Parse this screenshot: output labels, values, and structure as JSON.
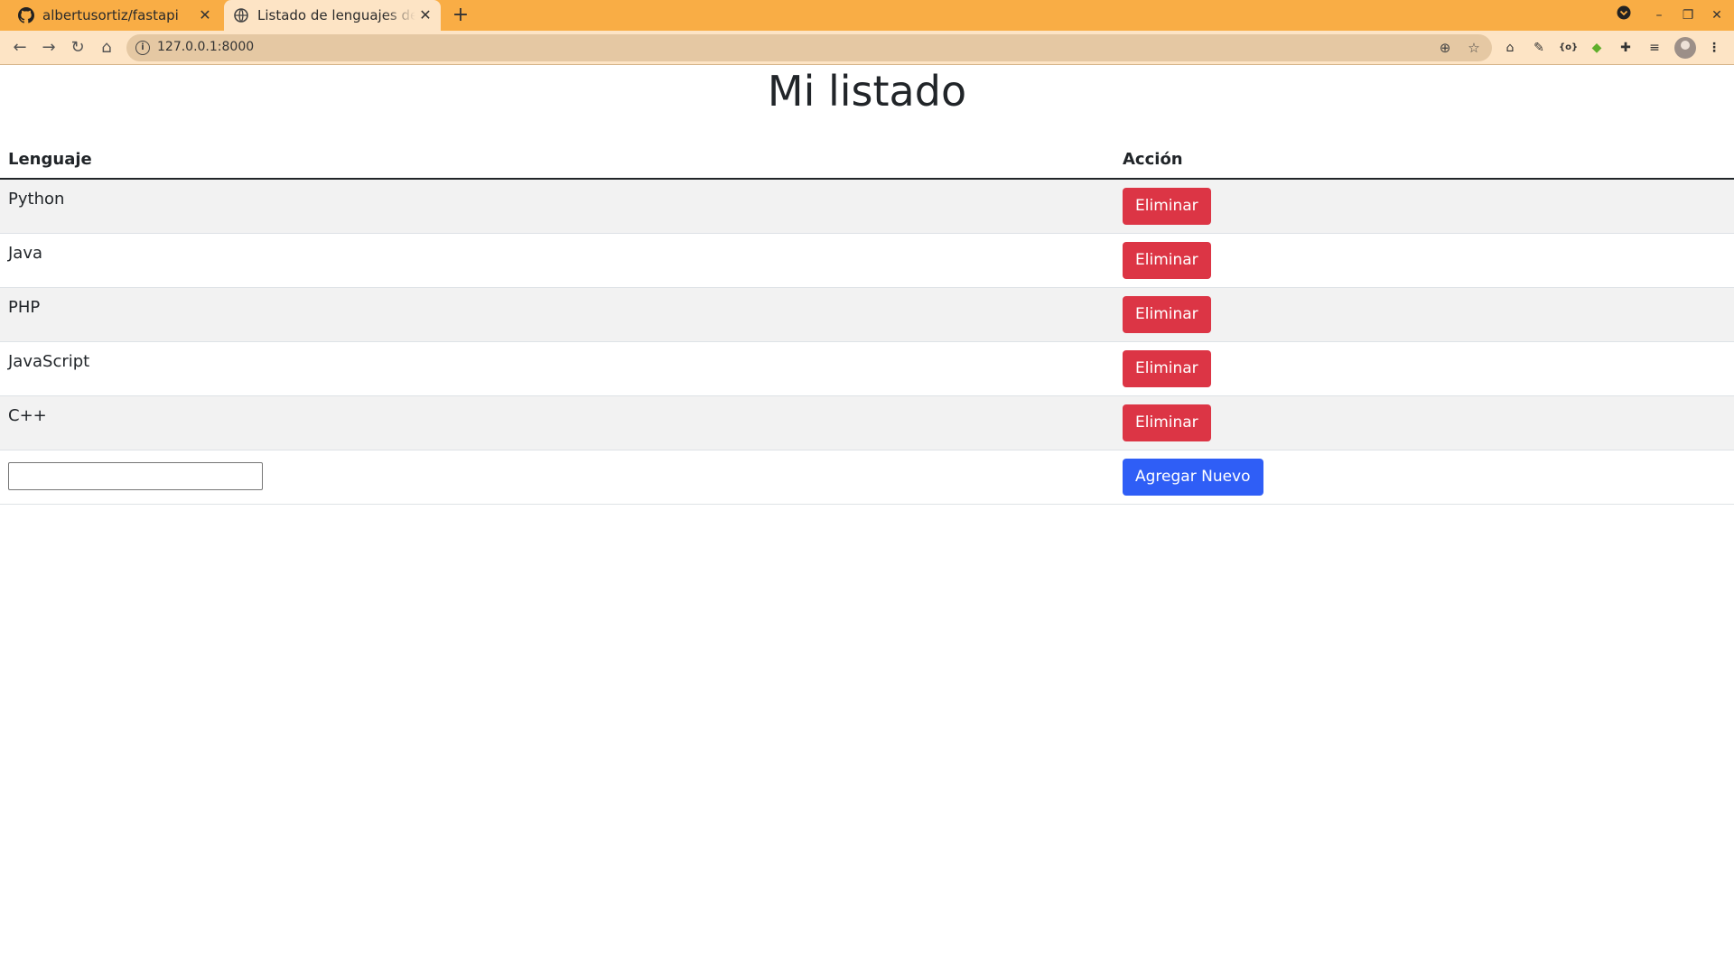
{
  "browser": {
    "tabs": [
      {
        "title": "albertusortiz/fastapi",
        "icon": "github-icon",
        "active": false
      },
      {
        "title": "Listado de lenguajes de programación",
        "icon": "globe-icon",
        "active": true
      }
    ],
    "url": "127.0.0.1:8000",
    "accent_color": "#f9ad45",
    "toolbar_color": "#fde4c5"
  },
  "page": {
    "title": "Mi listado",
    "table": {
      "headers": {
        "language": "Lenguaje",
        "action": "Acción"
      },
      "rows": [
        {
          "language": "Python",
          "action_label": "Eliminar"
        },
        {
          "language": "Java",
          "action_label": "Eliminar"
        },
        {
          "language": "PHP",
          "action_label": "Eliminar"
        },
        {
          "language": "JavaScript",
          "action_label": "Eliminar"
        },
        {
          "language": "C++",
          "action_label": "Eliminar"
        }
      ],
      "new_row": {
        "input_value": "",
        "add_label": "Agregar Nuevo"
      }
    },
    "colors": {
      "danger": "#dc3545",
      "primary": "#2f5ef6",
      "stripe": "#f2f2f2"
    }
  }
}
